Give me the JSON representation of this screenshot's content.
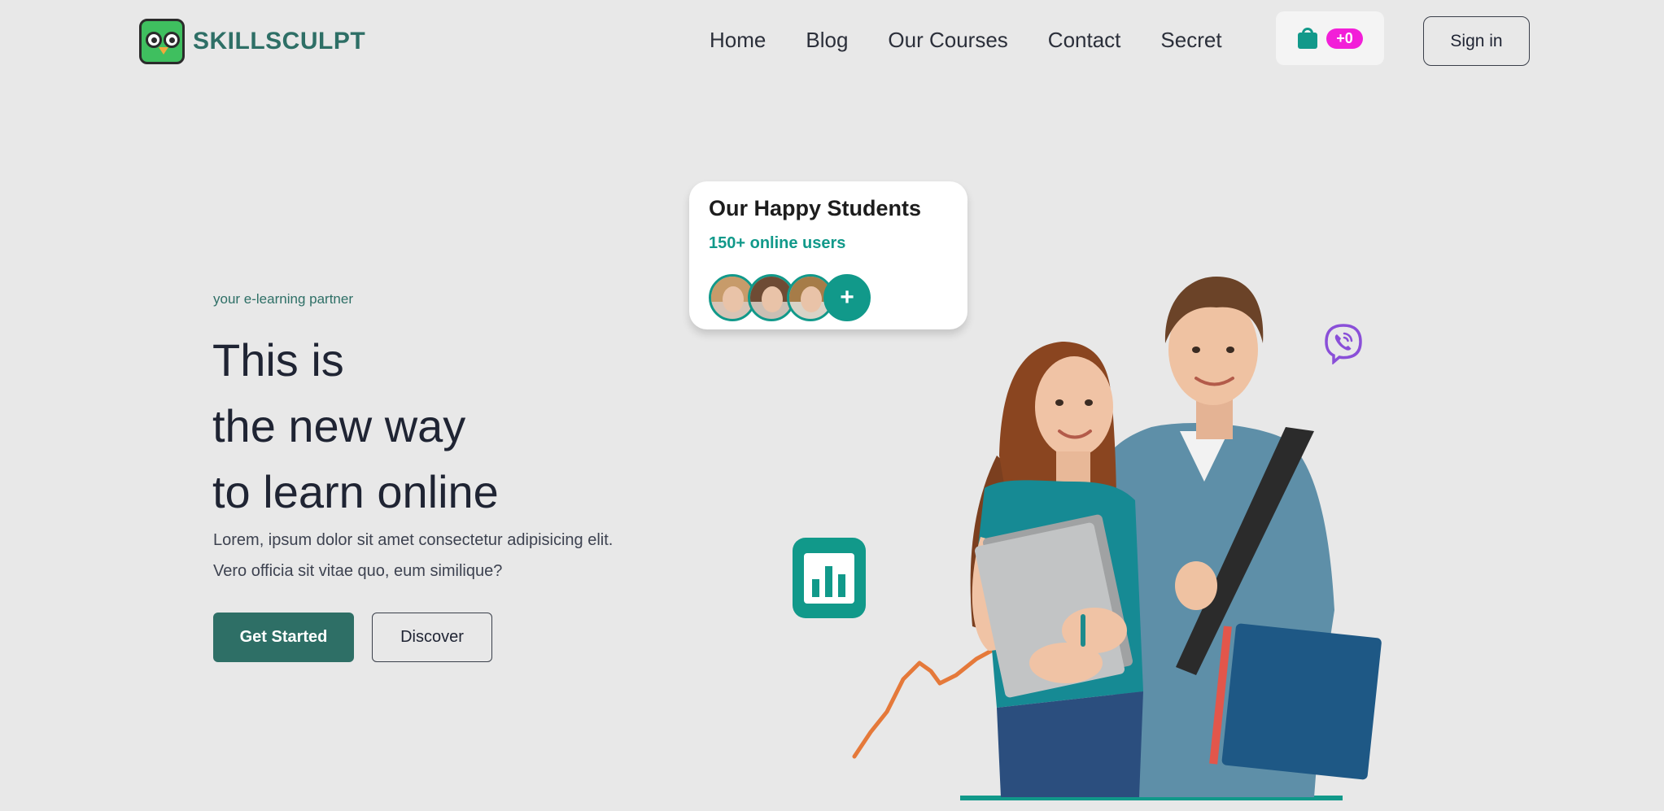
{
  "brand": {
    "name": "SKILLSCULPT"
  },
  "nav": {
    "items": [
      "Home",
      "Blog",
      "Our Courses",
      "Contact",
      "Secret"
    ],
    "cart_count": "+0",
    "signin_label": "Sign in"
  },
  "hero": {
    "tagline": "your e-learning partner",
    "headline": [
      "This is",
      "the new way",
      "to learn online"
    ],
    "lead": "Lorem, ipsum dolor sit amet consectetur adipisicing elit. Vero officia sit vitae quo, eum similique?",
    "primary_cta": "Get Started",
    "secondary_cta": "Discover"
  },
  "students_card": {
    "title": "Our Happy Students",
    "subtitle": "150+ online users",
    "more_label": "+"
  },
  "colors": {
    "accent": "#2e6f66",
    "teal": "#11998a",
    "badge": "#f21fd8",
    "background": "#e8e8e8"
  },
  "icons": [
    "logo-owl-icon",
    "shopping-bag-icon",
    "bar-chart-icon",
    "viber-phone-icon"
  ]
}
